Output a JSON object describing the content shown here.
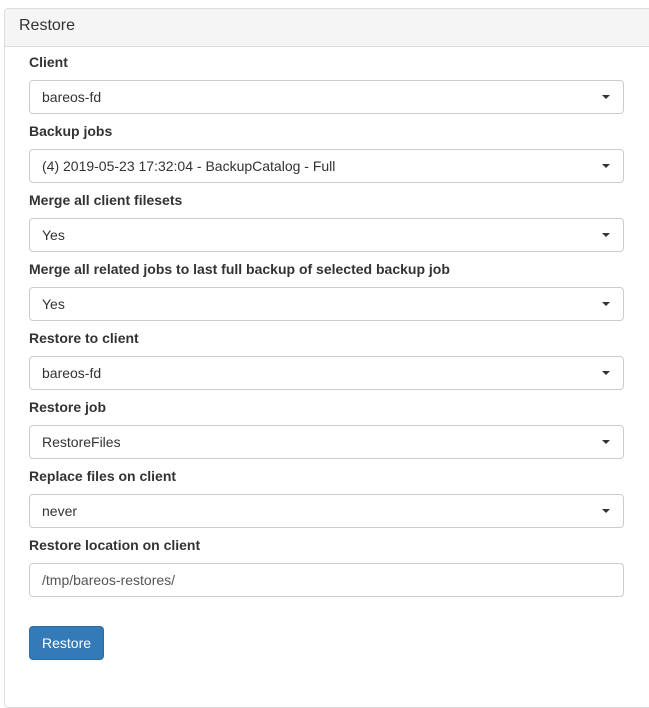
{
  "panel": {
    "title": "Restore"
  },
  "fields": [
    {
      "label": "Client",
      "type": "select",
      "value": "bareos-fd"
    },
    {
      "label": "Backup jobs",
      "type": "select",
      "value": "(4) 2019-05-23 17:32:04 - BackupCatalog - Full"
    },
    {
      "label": "Merge all client filesets",
      "type": "select",
      "value": "Yes"
    },
    {
      "label": "Merge all related jobs to last full backup of selected backup job",
      "type": "select",
      "value": "Yes"
    },
    {
      "label": "Restore to client",
      "type": "select",
      "value": "bareos-fd"
    },
    {
      "label": "Restore job",
      "type": "select",
      "value": "RestoreFiles"
    },
    {
      "label": "Replace files on client",
      "type": "select",
      "value": "never"
    },
    {
      "label": "Restore location on client",
      "type": "input",
      "value": "/tmp/bareos-restores/"
    }
  ],
  "submit": {
    "label": "Restore"
  },
  "colors": {
    "primary": "#337ab7",
    "panel_heading_bg": "#f5f5f5",
    "border": "#cccccc"
  }
}
